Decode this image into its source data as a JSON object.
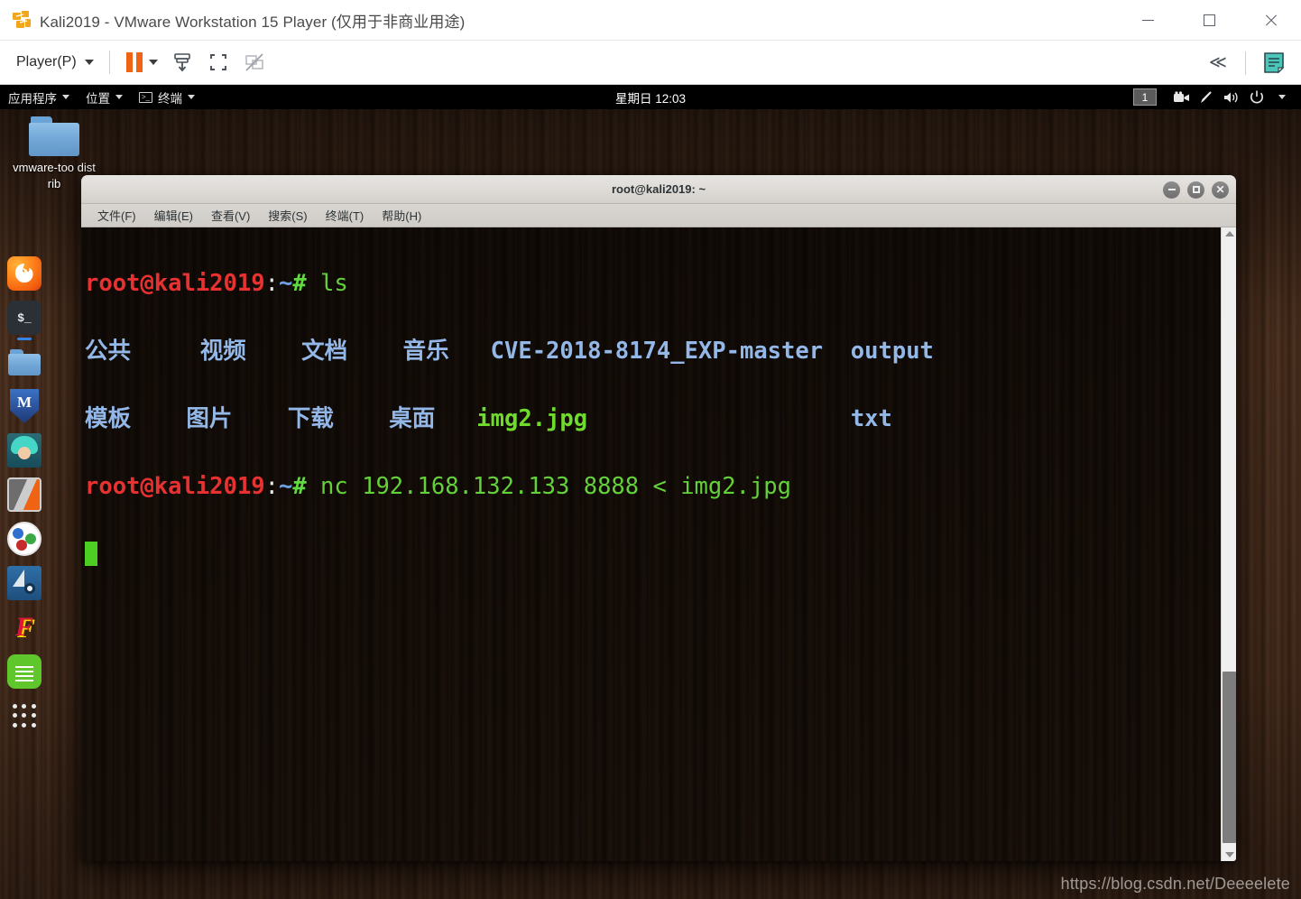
{
  "vmware": {
    "title": "Kali2019 - VMware Workstation 15 Player (仅用于非商业用途)",
    "app_icon": "vmware-logo-icon",
    "window_controls": {
      "minimize": "minimize-icon",
      "maximize": "maximize-icon",
      "close": "close-icon"
    },
    "toolbar": {
      "player_menu_label": "Player(P)",
      "buttons": [
        {
          "name": "suspend-button",
          "icon": "pause-icon"
        },
        {
          "name": "snapshot-button",
          "icon": "snapshot-icon"
        },
        {
          "name": "fullscreen-button",
          "icon": "fullscreen-icon"
        },
        {
          "name": "unity-button",
          "icon": "unity-disabled-icon"
        }
      ],
      "collapse_label": "≪",
      "notes_icon": "notes-icon"
    }
  },
  "gnome_panel": {
    "menus": [
      {
        "label": "应用程序",
        "icon": "applications-icon"
      },
      {
        "label": "位置",
        "icon": "places-icon"
      },
      {
        "label": "终端",
        "icon": "terminal-icon"
      }
    ],
    "clock": "星期日 12:03",
    "workspace_badge": "1",
    "tray": [
      {
        "name": "screencast-icon",
        "glyph": "🎥"
      },
      {
        "name": "brightness-icon",
        "glyph": "✎"
      },
      {
        "name": "volume-icon",
        "glyph": "🔊"
      },
      {
        "name": "power-icon",
        "glyph": "⏻"
      },
      {
        "name": "system-menu-caret-icon",
        "glyph": "▾"
      }
    ]
  },
  "desktop": {
    "icons": [
      {
        "name": "vmware-tools-distrib-folder",
        "label": "vmware-too distrib",
        "icon": "folder-icon"
      }
    ],
    "watermark": "https://blog.csdn.net/Deeeelete"
  },
  "dock": {
    "items": [
      {
        "name": "dock-item-firefox",
        "icon": "firefox-icon",
        "running": false
      },
      {
        "name": "dock-item-terminal",
        "icon": "terminal-icon",
        "running": true
      },
      {
        "name": "dock-item-files",
        "icon": "files-folder-icon",
        "running": false
      },
      {
        "name": "dock-item-metasploit",
        "icon": "metasploit-icon",
        "running": false
      },
      {
        "name": "dock-item-armitage",
        "icon": "armitage-icon",
        "running": false
      },
      {
        "name": "dock-item-burpsuite",
        "icon": "burpsuite-icon",
        "running": false
      },
      {
        "name": "dock-item-beef",
        "icon": "beef-icon",
        "running": false
      },
      {
        "name": "dock-item-wireshark",
        "icon": "wireshark-icon",
        "running": false
      },
      {
        "name": "dock-item-faraday",
        "icon": "faraday-icon",
        "running": false
      },
      {
        "name": "dock-item-texteditor",
        "icon": "text-editor-icon",
        "running": false
      },
      {
        "name": "dock-item-show-apps",
        "icon": "show-applications-icon",
        "running": false
      }
    ]
  },
  "terminal": {
    "title": "root@kali2019: ~",
    "window_controls": {
      "minimize": "minimize-icon",
      "maximize": "maximize-icon",
      "close": "close-icon"
    },
    "menus": [
      "文件(F)",
      "编辑(E)",
      "查看(V)",
      "搜索(S)",
      "终端(T)",
      "帮助(H)"
    ],
    "prompt": {
      "user_host": "root@kali2019",
      "colon": ":",
      "path": "~",
      "sigil": "#"
    },
    "lines": [
      {
        "type": "prompt",
        "command": "ls"
      },
      {
        "type": "listing",
        "cells": [
          "公共",
          "视频",
          "文档",
          "音乐",
          "CVE-2018-8174_EXP-master",
          "output"
        ]
      },
      {
        "type": "listing",
        "cells": [
          "模板",
          "图片",
          "下载",
          "桌面",
          "img2.jpg",
          "txt"
        ]
      },
      {
        "type": "prompt",
        "command": "nc 192.168.132.133 8888 < img2.jpg"
      },
      {
        "type": "cursor"
      }
    ],
    "listing_row1_dirs": "公共     视频    文档    音乐   CVE-2018-8174_EXP-master  output",
    "listing_row2_mixed_dirs": "模板    图片    下载    桌面   ",
    "listing_row2_file": "img2.jpg",
    "listing_row2_tail": "txt",
    "command_1": "ls",
    "command_2": "nc 192.168.132.133 8888 < img2.jpg",
    "colors": {
      "background": "#0b0907",
      "prompt_user": "#e83232",
      "prompt_path": "#6f9fe0",
      "command": "#63d13a",
      "directory": "#93b8e8",
      "executable": "#6fdc2d",
      "cursor": "#4ccf22"
    }
  }
}
